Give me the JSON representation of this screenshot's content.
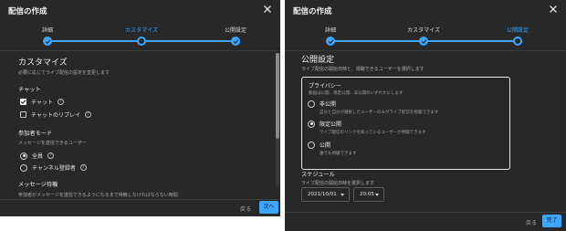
{
  "left": {
    "title": "配信の作成",
    "steps": [
      "詳細",
      "カスタマイズ",
      "公開設定"
    ],
    "heading": "カスタマイズ",
    "subheading": "必要に応じてライブ配信の設定を変更します",
    "chat_section": "チャット",
    "chat_label": "チャット",
    "chat_replay_label": "チャットのリプレイ",
    "participant_section": "参加者モード",
    "participant_sub": "メッセージを送信できるユーザー",
    "everyone_label": "全員",
    "members_label": "チャンネル登録者",
    "wait_section": "メッセージ待機",
    "wait_sub": "参加者がメッセージを送信できるようになるまで待機しなければならない時間",
    "back_label": "戻る",
    "next_label": "次へ"
  },
  "right": {
    "title": "配信の作成",
    "steps": [
      "詳細",
      "カスタマイズ",
      "公開設定"
    ],
    "heading": "公開設定",
    "subheading": "ライブ配信の開始日時と、視聴できるユーザーを選択します",
    "privacy_title": "プライバシー",
    "privacy_sub": "動画は公開、限定公開、非公開のいずれかにします",
    "options": [
      {
        "title": "非公開",
        "desc": "自分と自分が選択したユーザーのみがライブ配信を視聴できます"
      },
      {
        "title": "限定公開",
        "desc": "ライブ配信のリンクを知っているユーザーが視聴できます"
      },
      {
        "title": "公開",
        "desc": "誰でも視聴できます"
      }
    ],
    "schedule_title": "スケジュール",
    "schedule_sub": "ライブ配信の開始日時を選択します",
    "date": "2021/10/01",
    "time": "20:05",
    "back_label": "戻る",
    "done_label": "完了"
  },
  "colors": {
    "accent": "#3ea6ff",
    "panel": "#282828"
  }
}
